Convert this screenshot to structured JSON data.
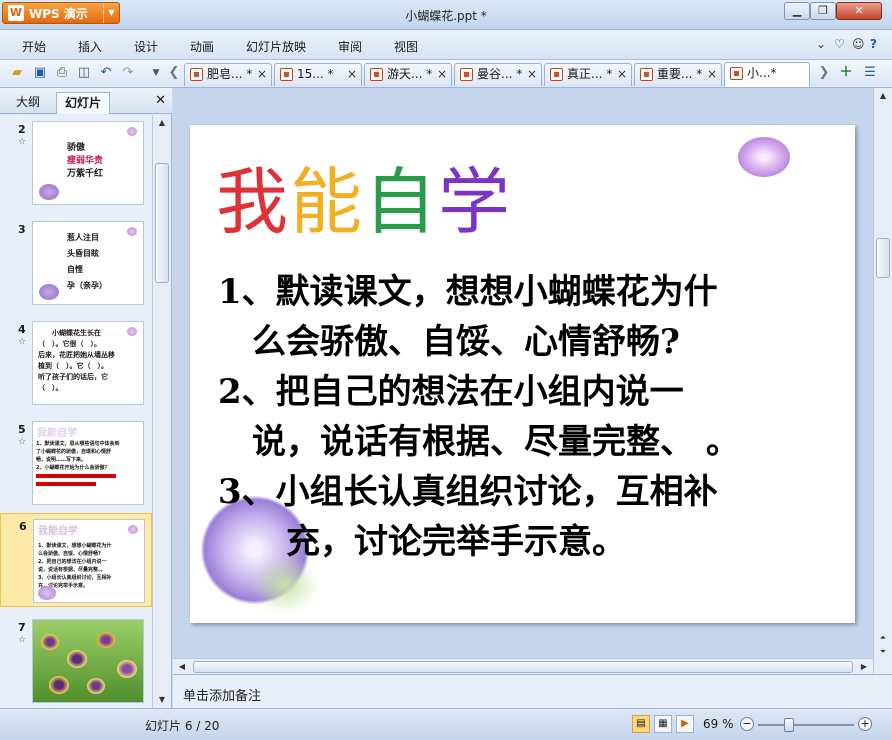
{
  "app": {
    "name": "WPS 演示",
    "window_title": "小蝴蝶花.ppt *"
  },
  "menu": [
    "开始",
    "插入",
    "设计",
    "动画",
    "幻灯片放映",
    "审阅",
    "视图"
  ],
  "doc_tabs": [
    {
      "label": "肥皂... *"
    },
    {
      "label": "15... *"
    },
    {
      "label": "游天... *"
    },
    {
      "label": "曼谷... *"
    },
    {
      "label": "真正... *"
    },
    {
      "label": "重要... *"
    },
    {
      "label": "小...*"
    }
  ],
  "left_panel": {
    "tabs": [
      "大纲",
      "幻灯片"
    ],
    "thumbnails": [
      {
        "num": "2",
        "lines": [
          "骄傲",
          "瘦弱华贵",
          "万紫千红"
        ]
      },
      {
        "num": "3",
        "lines": [
          "惹人注目",
          "头昏目眩",
          "自悭",
          "孕（亲孕）"
        ]
      },
      {
        "num": "4",
        "lines": [
          "小蝴蝶花生长在",
          "（　）。它很（　）。",
          "后来，花匠把她从墙丛移",
          "植到（　）。它（　）。",
          "听了孩子们的话后，它",
          "（　）。"
        ]
      },
      {
        "num": "5",
        "lines": [
          "我能自学",
          "1、默读课文，思从哪些语句中体会到",
          "了小蝴蝶花的骄傲，自堪和心情舒",
          "畅，说明……写下来。",
          "2、小蝴蝶花开始为什么会骄傲？"
        ]
      },
      {
        "num": "6",
        "lines": [
          "我能自学",
          "1、默读课文，想想小蝴蝶花为什",
          "么会骄傲、自馁、心情舒畅?",
          "2、把自己的想法在小组内说一",
          "说，说话有根据、尽量完整、。",
          "3、小组长认真组织讨论，互相补",
          "充，讨论完举手示意。"
        ]
      },
      {
        "num": "7",
        "lines": []
      }
    ]
  },
  "slide": {
    "title": "我能自学",
    "title_colors": [
      "#e0303a",
      "#f0b020",
      "#2a9c4a",
      "#7a34c6"
    ],
    "body": [
      "1、默读课文，想想小蝴蝶花为什",
      "　么会骄傲、自馁、心情舒畅?",
      "2、把自己的想法在小组内说一",
      "　说，说话有根据、尽量完整、 。",
      " 3、小组长认真组织讨论，互相补",
      "　　充，讨论完举手示意。"
    ]
  },
  "notes_placeholder": "单击添加备注",
  "status": {
    "slide_counter": "幻灯片 6 / 20",
    "zoom": "69 %"
  }
}
